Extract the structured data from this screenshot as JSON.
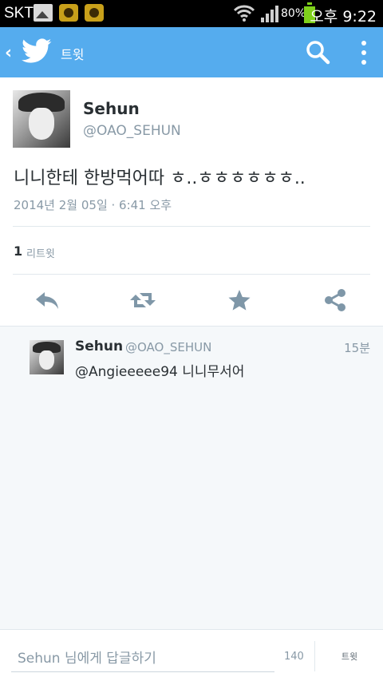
{
  "status_bar": {
    "carrier": "SKT",
    "battery": "80%",
    "time": "오후 9:22",
    "battery_color": "#7fd11b"
  },
  "action_bar": {
    "back_icon": "chevron-left-icon",
    "logo_icon": "twitter-bird-icon",
    "title": "트윗",
    "search_icon": "search-icon",
    "overflow_icon": "more-vert-icon",
    "color": "#55acee"
  },
  "tweet": {
    "author_name": "Sehun",
    "author_handle": "@OAO_SEHUN",
    "text": "니니한테 한방먹어따 ㅎ..ㅎㅎㅎㅎㅎㅎ..",
    "timestamp": "2014년 2월 05일 · 6:41 오후",
    "retweet_count": "1",
    "retweet_label": "리트윗",
    "actions": [
      "reply-icon",
      "retweet-icon",
      "favorite-star-icon",
      "share-icon"
    ]
  },
  "replies": [
    {
      "name": "Sehun",
      "handle": "@OAO_SEHUN",
      "time": "15분",
      "text": "@Angieeeee94 니니무서어"
    }
  ],
  "compose": {
    "placeholder": "Sehun 님에게 답글하기",
    "char_count": "140",
    "send_label": "트윗"
  }
}
